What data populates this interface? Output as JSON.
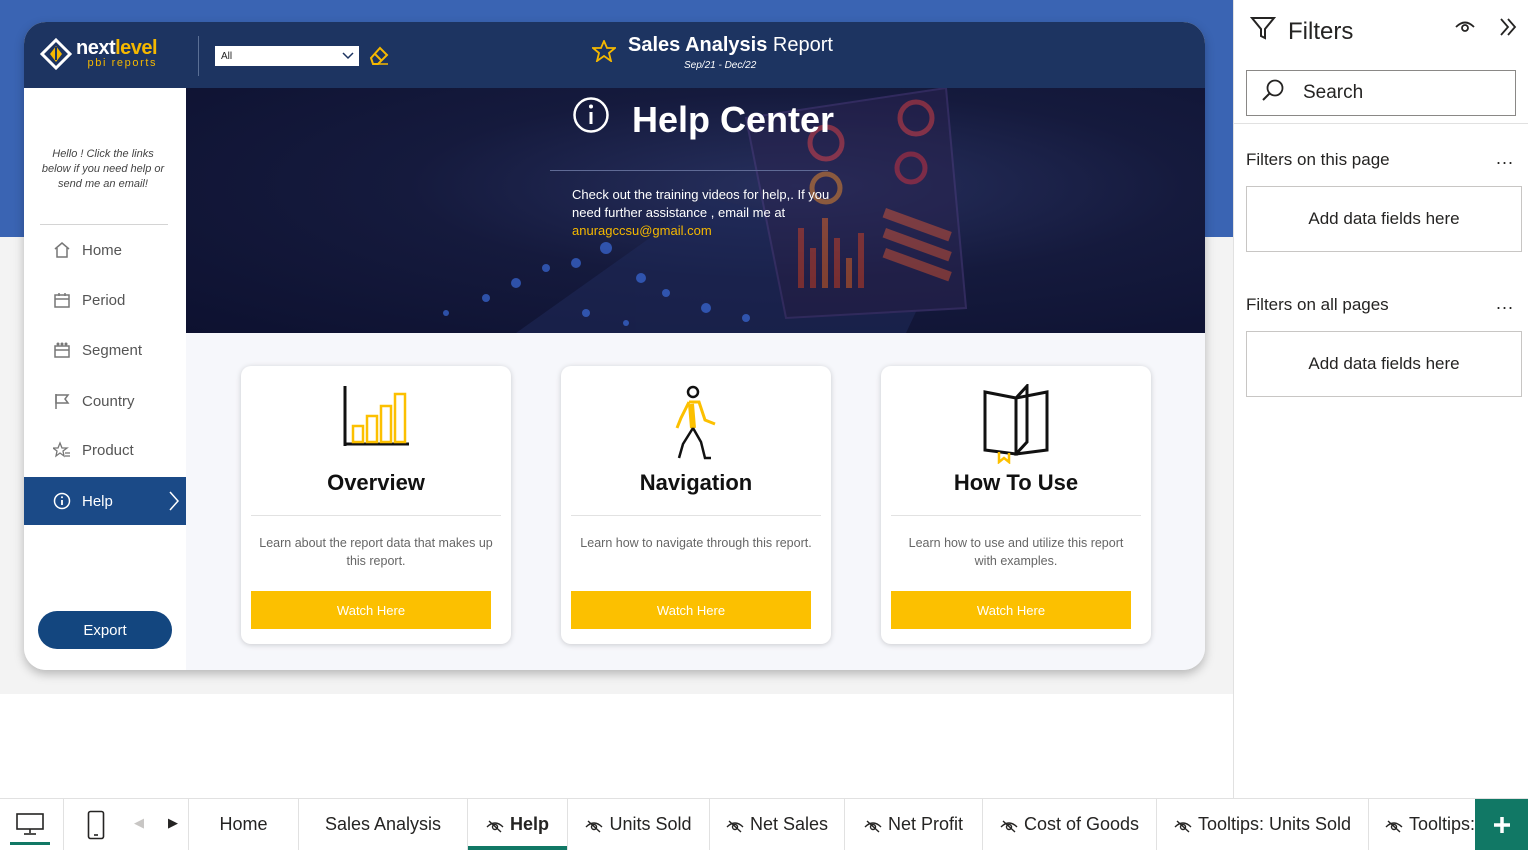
{
  "header": {
    "logo_main": "next",
    "logo_accent": "level",
    "logo_sub": "pbi reports",
    "slicer_value": "All",
    "title_bold": "Sales Analysis",
    "title_rest": " Report",
    "date_range": "Sep/21 - Dec/22"
  },
  "sidebar": {
    "hello_text": "Hello ! Click the links below if you need help or send me an email!",
    "items": [
      {
        "label": "Home",
        "icon": "home-icon"
      },
      {
        "label": "Period",
        "icon": "calendar-icon"
      },
      {
        "label": "Segment",
        "icon": "segment-icon"
      },
      {
        "label": "Country",
        "icon": "flag-icon"
      },
      {
        "label": "Product",
        "icon": "product-star-icon"
      },
      {
        "label": "Help",
        "icon": "info-icon",
        "active": true
      }
    ],
    "export_label": "Export"
  },
  "hero": {
    "title": "Help Center",
    "text": "Check out the training videos for help,. If you need further assistance , email me at",
    "email": "anuragccsu@gmail.com"
  },
  "cards": [
    {
      "title": "Overview",
      "desc": "Learn about the report data that makes up this report.",
      "button": "Watch Here",
      "icon": "bar-chart-icon"
    },
    {
      "title": "Navigation",
      "desc": "Learn how to navigate through this report.",
      "button": "Watch Here",
      "icon": "walking-person-icon"
    },
    {
      "title": "How To Use",
      "desc": "Learn how to use and utilize this report with examples.",
      "button": "Watch Here",
      "icon": "open-book-icon"
    }
  ],
  "filters": {
    "title": "Filters",
    "search_placeholder": "Search",
    "this_page_label": "Filters on this page",
    "all_pages_label": "Filters on all pages",
    "dots": "...",
    "well_text": "Add data fields here"
  },
  "tabs": [
    {
      "label": "Home",
      "hidden": false
    },
    {
      "label": "Sales Analysis",
      "hidden": false
    },
    {
      "label": "Help",
      "hidden": true,
      "active": true
    },
    {
      "label": "Units Sold",
      "hidden": true
    },
    {
      "label": "Net Sales",
      "hidden": true
    },
    {
      "label": "Net Profit",
      "hidden": true
    },
    {
      "label": "Cost of Goods",
      "hidden": true
    },
    {
      "label": "Tooltips: Units Sold",
      "hidden": true
    },
    {
      "label": "Tooltips:",
      "hidden": true
    }
  ],
  "colors": {
    "header_navy": "#1d3461",
    "accent_yellow": "#fcc000",
    "active_nav": "#1b4a87",
    "pbi_green": "#117865",
    "page_blue": "#3a64b3"
  }
}
